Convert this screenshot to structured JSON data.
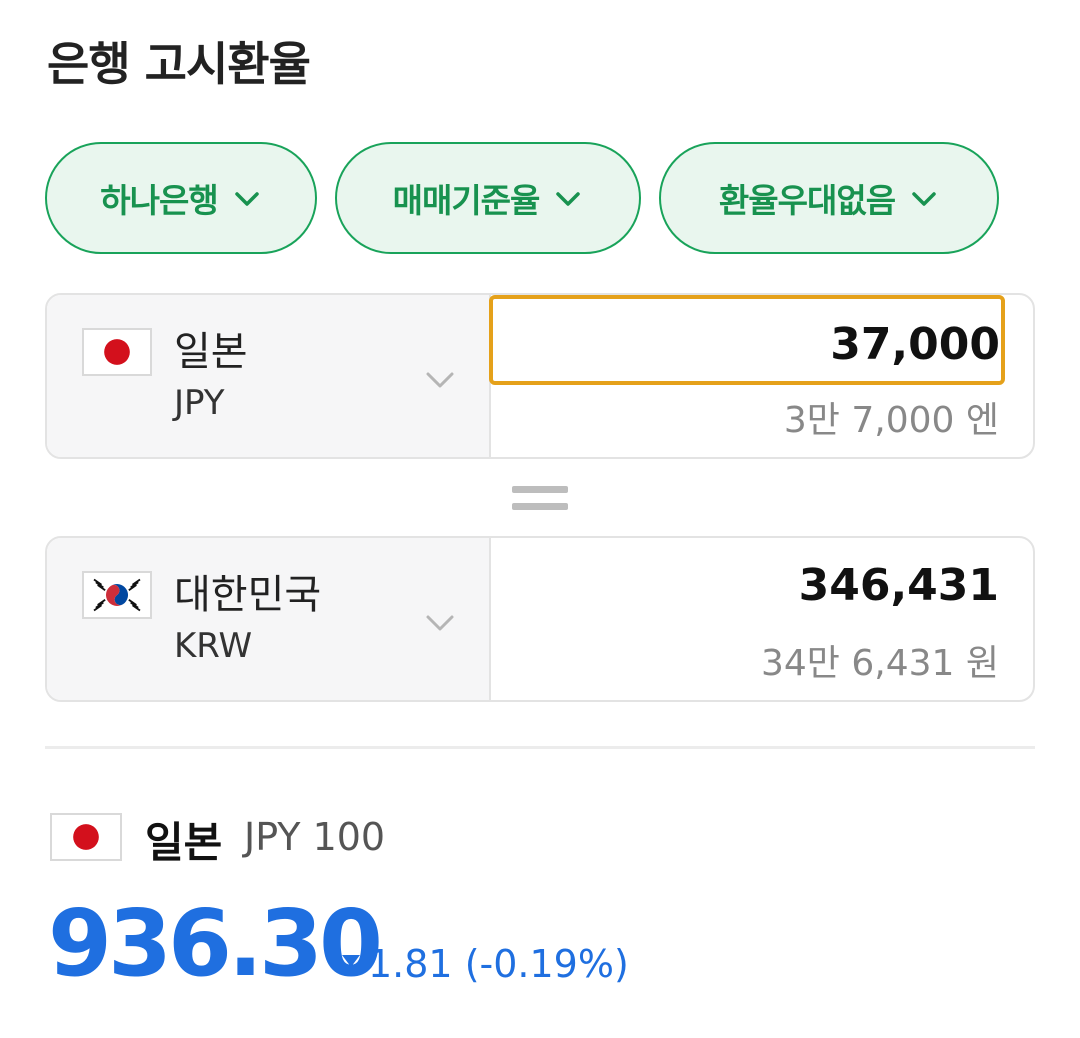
{
  "title": "은행 고시환율",
  "filters": [
    {
      "label": "하나은행"
    },
    {
      "label": "매매기준율"
    },
    {
      "label": "환율우대없음"
    }
  ],
  "from": {
    "country": "일본",
    "code": "JPY",
    "amount": "37,000",
    "amount_text": "3만 7,000 엔"
  },
  "to": {
    "country": "대한민국",
    "code": "KRW",
    "amount": "346,431",
    "amount_text": "34만 6,431 원"
  },
  "rate": {
    "country": "일본",
    "unit": "JPY 100",
    "value": "936.30",
    "change": "1.81 (-0.19%)",
    "direction": "down"
  },
  "colors": {
    "chip_border": "#19a35a",
    "chip_bg": "#e9f6ee",
    "chip_text": "#18924f",
    "focus_border": "#e5a11a",
    "rate_blue": "#1f6fe0"
  },
  "icons": {
    "chip_dropdown": "chevron-down-icon",
    "currency_dropdown": "chevron-down-icon",
    "equals": "equals-icon",
    "change_direction": "triangle-down-icon"
  }
}
